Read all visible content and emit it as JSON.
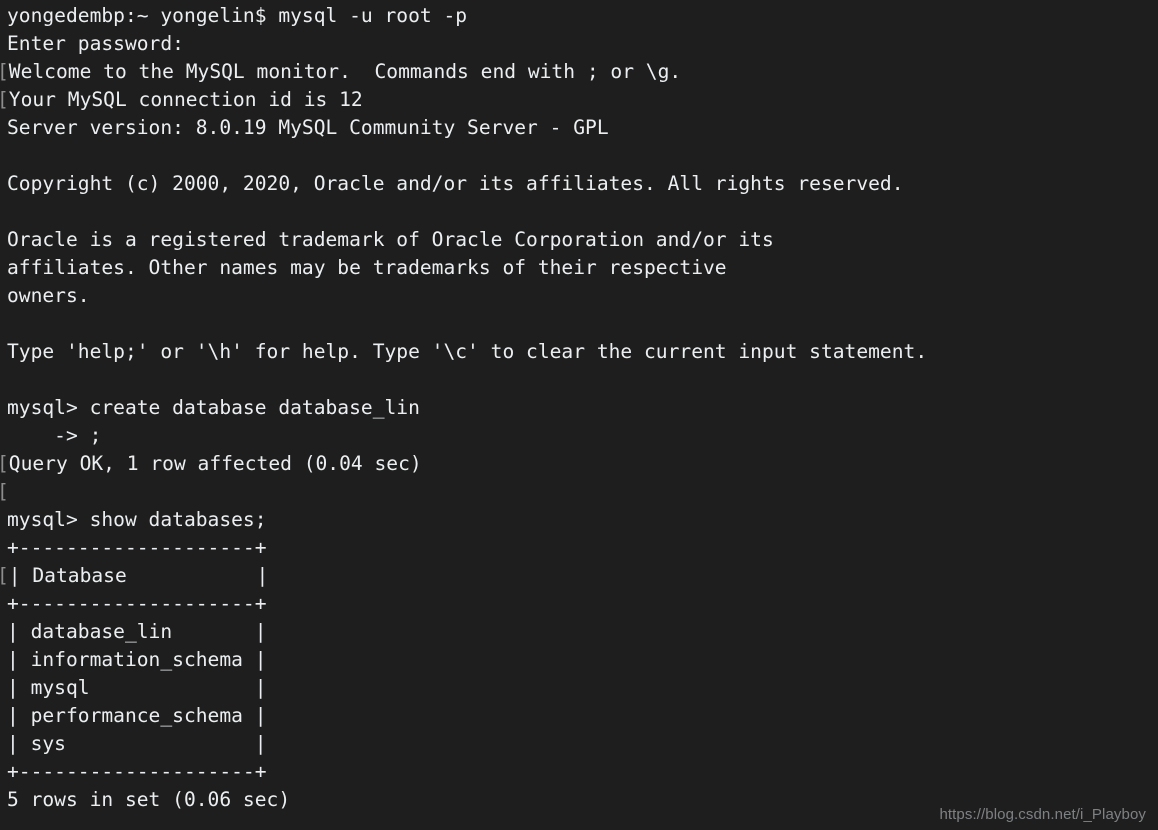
{
  "terminal": {
    "background_color": "#1e1e1e",
    "foreground_color": "#eceff1",
    "prompt_mark_color": "#8d8d8d",
    "prompt_mark_glyph": "[",
    "lines": [
      {
        "id": "shell-prompt-command",
        "text": "yongedembp:~ yongelin$ mysql -u root -p"
      },
      {
        "id": "password-prompt",
        "text": "Enter password:"
      },
      {
        "id": "welcome-banner",
        "text": "Welcome to the MySQL monitor.  Commands end with ; or \\g.",
        "mark": true
      },
      {
        "id": "connection-id",
        "text": "Your MySQL connection id is 12",
        "mark": true
      },
      {
        "id": "server-version",
        "text": "Server version: 8.0.19 MySQL Community Server - GPL"
      },
      {
        "id": "blank-1",
        "text": ""
      },
      {
        "id": "copyright-notice",
        "text": "Copyright (c) 2000, 2020, Oracle and/or its affiliates. All rights reserved."
      },
      {
        "id": "blank-2",
        "text": ""
      },
      {
        "id": "trademark-notice-1",
        "text": "Oracle is a registered trademark of Oracle Corporation and/or its"
      },
      {
        "id": "trademark-notice-2",
        "text": "affiliates. Other names may be trademarks of their respective"
      },
      {
        "id": "trademark-notice-3",
        "text": "owners."
      },
      {
        "id": "blank-3",
        "text": ""
      },
      {
        "id": "help-hint",
        "text": "Type 'help;' or '\\h' for help. Type '\\c' to clear the current input statement."
      },
      {
        "id": "blank-4",
        "text": ""
      },
      {
        "id": "create-database-command",
        "text": "mysql> create database database_lin"
      },
      {
        "id": "continuation-prompt",
        "text": "    -> ;"
      },
      {
        "id": "query-ok-result",
        "text": "Query OK, 1 row affected (0.04 sec)",
        "mark": true
      },
      {
        "id": "blank-5",
        "text": "",
        "mark": true
      },
      {
        "id": "show-databases-command",
        "text": "mysql> show databases;"
      },
      {
        "id": "table-top-border",
        "text": "+--------------------+"
      },
      {
        "id": "table-header-row",
        "text": "| Database           |",
        "mark": true
      },
      {
        "id": "table-header-separator",
        "text": "+--------------------+"
      },
      {
        "id": "table-row-1",
        "text": "| database_lin       |"
      },
      {
        "id": "table-row-2",
        "text": "| information_schema |"
      },
      {
        "id": "table-row-3",
        "text": "| mysql              |"
      },
      {
        "id": "table-row-4",
        "text": "| performance_schema |"
      },
      {
        "id": "table-row-5",
        "text": "| sys                |"
      },
      {
        "id": "table-bottom-border",
        "text": "+--------------------+"
      },
      {
        "id": "rows-in-set-result",
        "text": "5 rows in set (0.06 sec)"
      }
    ],
    "session": {
      "host_prompt": "yongedembp:~",
      "user": "yongelin$",
      "command": "mysql -u root -p",
      "mysql_connection_id": "12",
      "server_version": "8.0.19",
      "server_edition": "MySQL Community Server - GPL",
      "created_database": "database_lin",
      "create_timing": "0.04 sec",
      "select_timing": "0.06 sec",
      "row_count": "5"
    },
    "result_table": {
      "column_header": "Database",
      "rows": [
        "database_lin",
        "information_schema",
        "mysql",
        "performance_schema",
        "sys"
      ]
    }
  },
  "watermark": {
    "text": "https://blog.csdn.net/i_Playboy"
  }
}
